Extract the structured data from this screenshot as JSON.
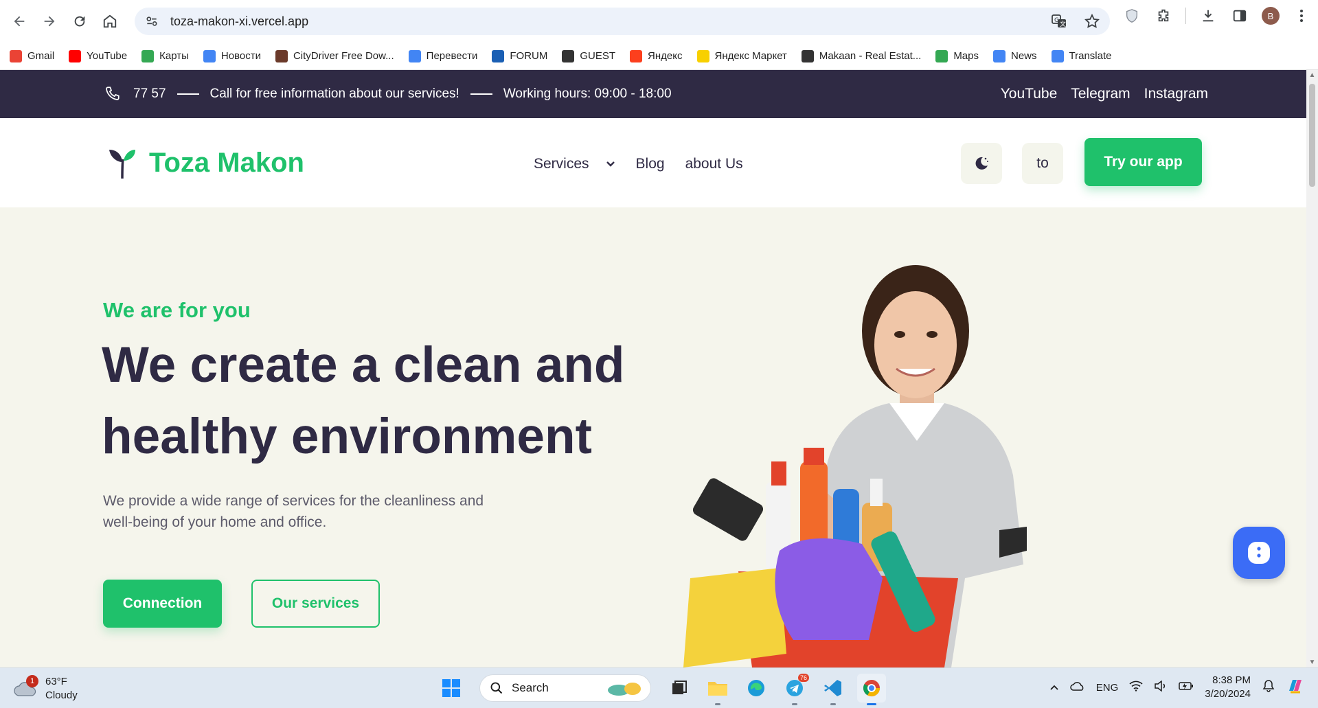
{
  "browser": {
    "url": "toza-makon-xi.vercel.app",
    "profile_initial": "B"
  },
  "bookmarks": [
    {
      "label": "Gmail",
      "color": "#ea4335"
    },
    {
      "label": "YouTube",
      "color": "#ff0000"
    },
    {
      "label": "Карты",
      "color": "#34a853"
    },
    {
      "label": "Новости",
      "color": "#4285f4"
    },
    {
      "label": "CityDriver Free Dow...",
      "color": "#6b3a2a"
    },
    {
      "label": "Перевести",
      "color": "#4285f4"
    },
    {
      "label": "FORUM",
      "color": "#1a5fb4"
    },
    {
      "label": "GUEST",
      "color": "#333333"
    },
    {
      "label": "Яндекс",
      "color": "#fc3f1d"
    },
    {
      "label": "Яндекс Маркет",
      "color": "#f8d000"
    },
    {
      "label": "Makaan - Real Estat...",
      "color": "#333333"
    },
    {
      "label": "Maps",
      "color": "#34a853"
    },
    {
      "label": "News",
      "color": "#4285f4"
    },
    {
      "label": "Translate",
      "color": "#4285f4"
    }
  ],
  "topbar": {
    "phone": "77 57",
    "info": "Call for free information about our services!",
    "hours": "Working hours: 09:00 - 18:00",
    "socials": [
      "YouTube",
      "Telegram",
      "Instagram"
    ]
  },
  "header": {
    "logo": "Toza Makon",
    "menu": {
      "services": "Services",
      "blog": "Blog",
      "about": "about Us"
    },
    "lang": "to",
    "cta": "Try our app"
  },
  "hero": {
    "eyebrow": "We are for you",
    "headline": "We create a clean and healthy environment",
    "description": "We provide a wide range of services for the cleanliness and well-being of your home and office.",
    "btn_connection": "Connection",
    "btn_services": "Our services"
  },
  "taskbar": {
    "weather_temp": "63°F",
    "weather_desc": "Cloudy",
    "weather_badge": "1",
    "search": "Search",
    "telegram_badge": "76",
    "lang": "ENG",
    "time": "8:38 PM",
    "date": "3/20/2024"
  },
  "colors": {
    "brand_green": "#1fc16b",
    "dark_navy": "#2f2a44",
    "hero_bg": "#f5f5ec"
  }
}
